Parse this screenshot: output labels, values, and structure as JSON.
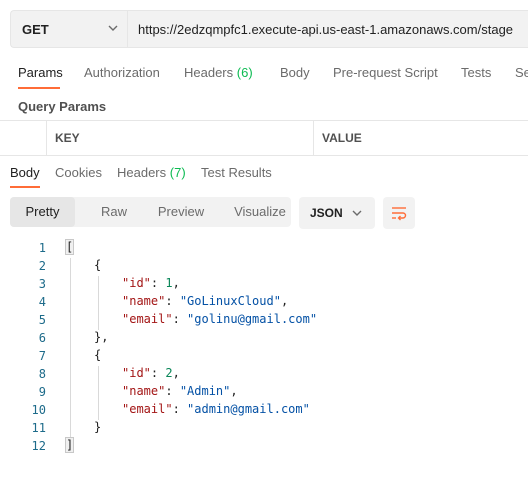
{
  "request": {
    "method": "GET",
    "url": "https://2edzqmpfc1.execute-api.us-east-1.amazonaws.com/stage",
    "tabs": [
      {
        "label": "Params",
        "count": ""
      },
      {
        "label": "Authorization",
        "count": ""
      },
      {
        "label": "Headers",
        "count": "(6)"
      },
      {
        "label": "Body",
        "count": ""
      },
      {
        "label": "Pre-request Script",
        "count": ""
      },
      {
        "label": "Tests",
        "count": ""
      },
      {
        "label": "Se",
        "count": ""
      }
    ],
    "query_params_title": "Query Params",
    "table_headers": [
      "KEY",
      "VALUE"
    ]
  },
  "response": {
    "tabs": [
      {
        "label": "Body",
        "count": ""
      },
      {
        "label": "Cookies",
        "count": ""
      },
      {
        "label": "Headers",
        "count": "(7)"
      },
      {
        "label": "Test Results",
        "count": ""
      }
    ],
    "view_modes": [
      "Pretty",
      "Raw",
      "Preview",
      "Visualize"
    ],
    "format": "JSON",
    "line_numbers": [
      "1",
      "2",
      "3",
      "4",
      "5",
      "6",
      "7",
      "8",
      "9",
      "10",
      "11",
      "12"
    ],
    "json": [
      {
        "id": "1",
        "name": "\"GoLinuxCloud\"",
        "email": "\"golinu@gmail.com\""
      },
      {
        "id": "2",
        "name": "\"Admin\"",
        "email": "\"admin@gmail.com\""
      }
    ],
    "keys": {
      "id": "\"id\"",
      "name": "\"name\"",
      "email": "\"email\""
    }
  },
  "colors": {
    "accent": "#ff6c37",
    "count_green": "#0cbb52"
  },
  "icons": [
    "chevron-down-icon",
    "wrap-lines-icon"
  ]
}
